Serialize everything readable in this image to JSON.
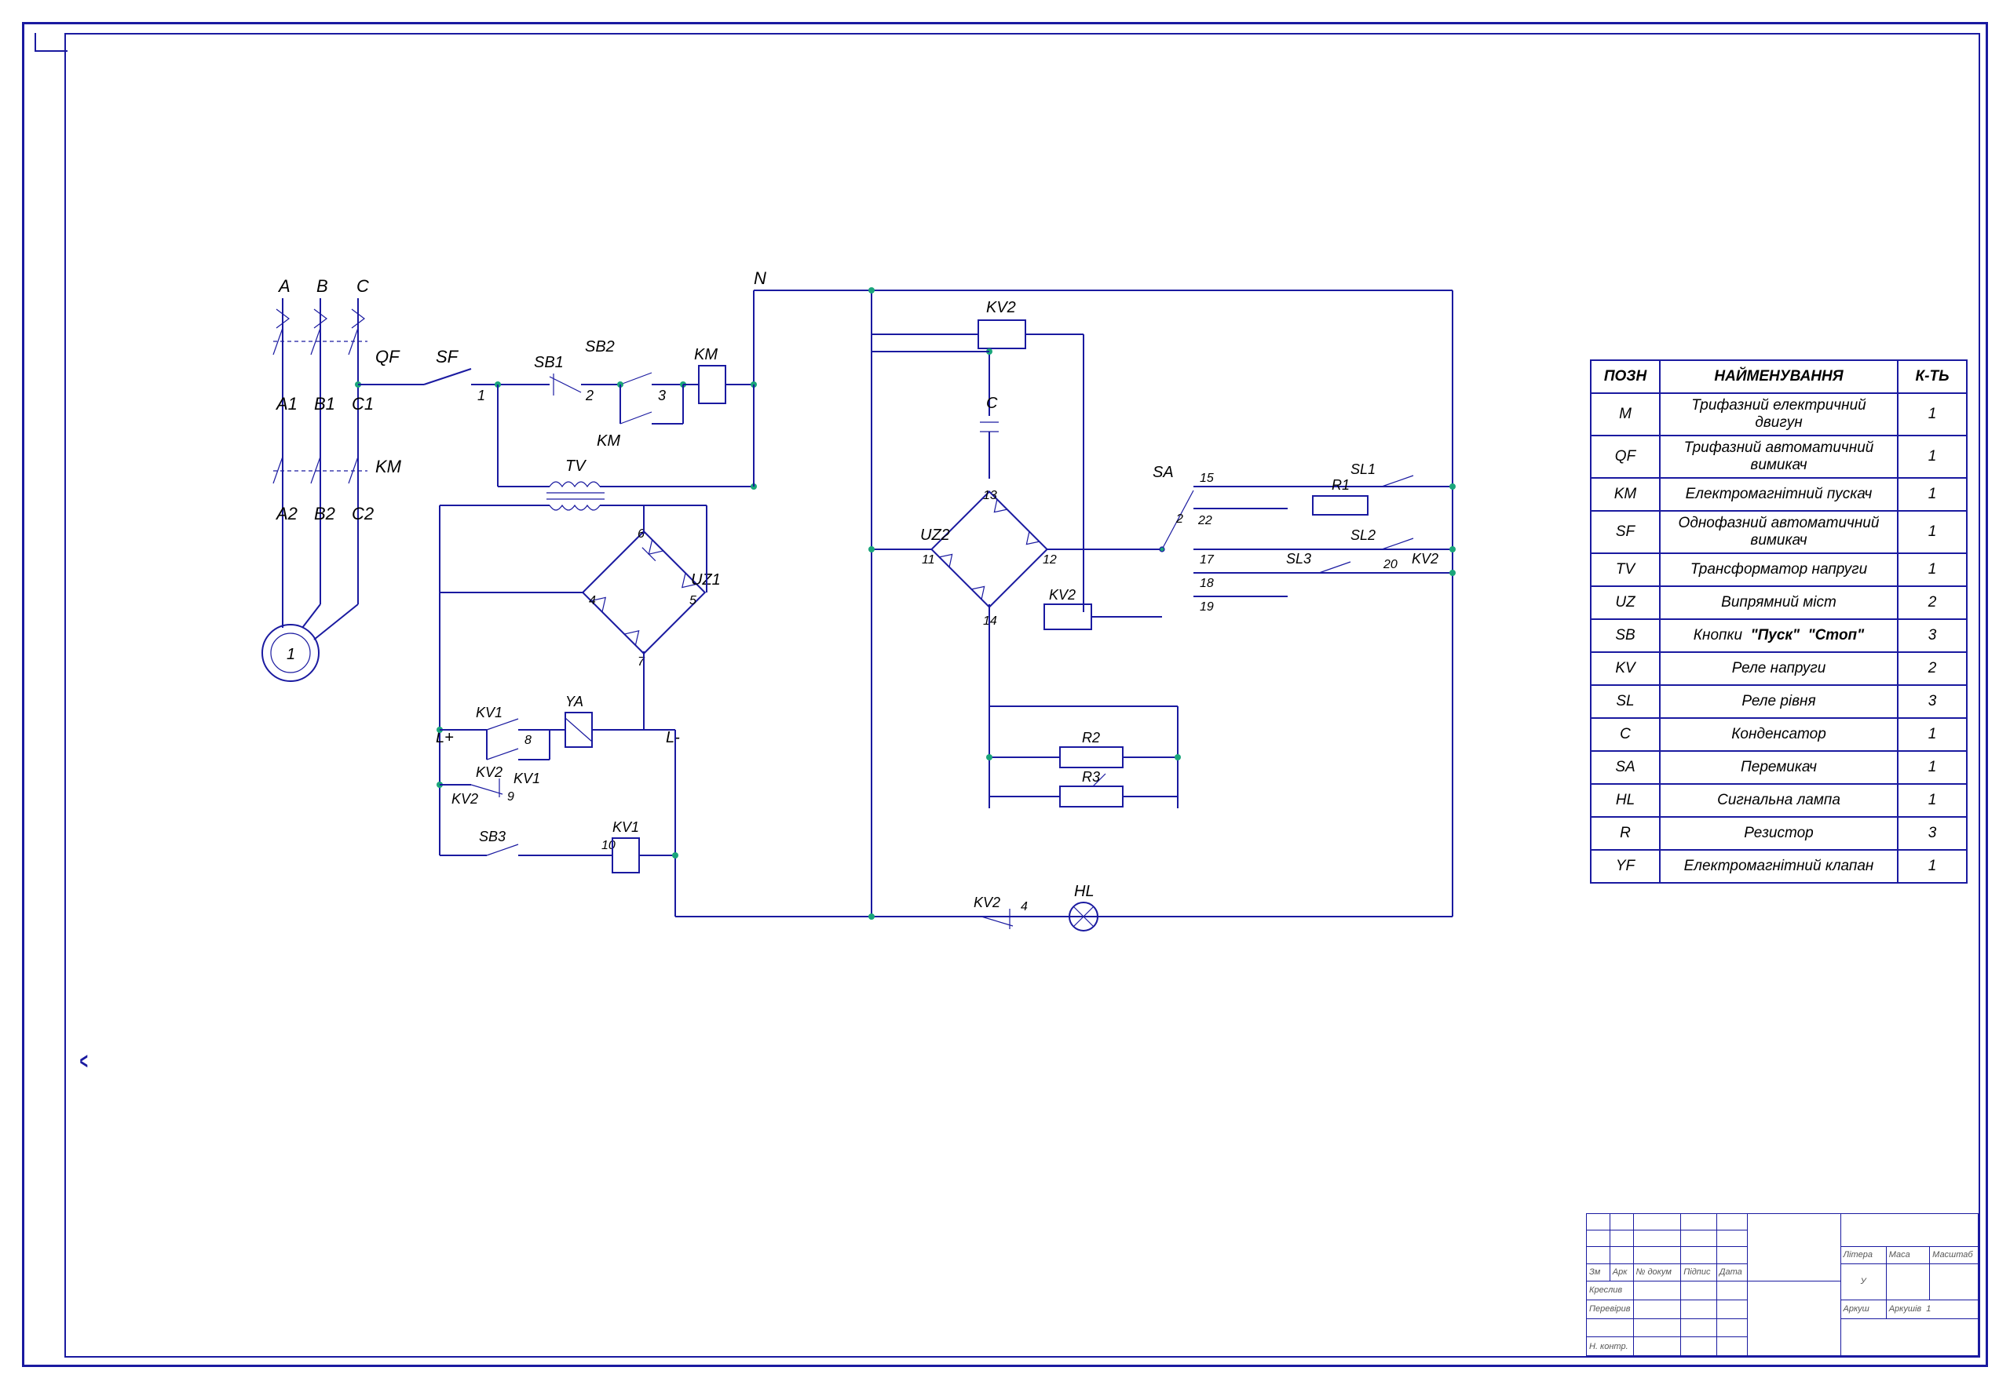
{
  "schematic": {
    "phases": {
      "A": "A",
      "B": "B",
      "C": "C",
      "N": "N"
    },
    "terminals": {
      "A1": "A1",
      "B1": "B1",
      "C1": "C1",
      "A2": "A2",
      "B2": "B2",
      "C2": "C2",
      "Lplus": "L+",
      "Lminus": "L-"
    },
    "components": {
      "QF": "QF",
      "SF": "SF",
      "SB1": "SB1",
      "SB2": "SB2",
      "SB3": "SB3",
      "KM": "KM",
      "TV": "TV",
      "UZ1": "UZ1",
      "UZ2": "UZ2",
      "KV1": "KV1",
      "KV2": "KV2",
      "YA": "YA",
      "SA": "SA",
      "SL1": "SL1",
      "SL2": "SL2",
      "SL3": "SL3",
      "R1": "R1",
      "R2": "R2",
      "R3": "R3",
      "C": "C",
      "HL": "HL",
      "motor": "1"
    },
    "node_numbers": [
      "1",
      "2",
      "3",
      "4",
      "5",
      "6",
      "7",
      "8",
      "9",
      "10",
      "11",
      "12",
      "13",
      "14",
      "15",
      "17",
      "18",
      "19",
      "20",
      "22",
      "4"
    ]
  },
  "parts_table": {
    "headers": {
      "des": "ПОЗН",
      "name": "НАЙМЕНУВАННЯ",
      "qty": "К-ТЬ"
    },
    "rows": [
      {
        "des": "M",
        "name": "Трифазний електричний двигун",
        "qty": "1"
      },
      {
        "des": "QF",
        "name": "Трифазний автоматичний вимикач",
        "qty": "1"
      },
      {
        "des": "KM",
        "name": "Електромагнітний пускач",
        "qty": "1"
      },
      {
        "des": "SF",
        "name": "Однофазний автоматичний вимикач",
        "qty": "1"
      },
      {
        "des": "TV",
        "name": "Трансформатор напруги",
        "qty": "1"
      },
      {
        "des": "UZ",
        "name": "Випрямний міст",
        "qty": "2"
      },
      {
        "des": "SB",
        "name": "Кнопки  \"Пуск\"  \"Стоп\"",
        "qty": "3"
      },
      {
        "des": "KV",
        "name": "Реле напруги",
        "qty": "2"
      },
      {
        "des": "SL",
        "name": "Реле рівня",
        "qty": "3"
      },
      {
        "des": "C",
        "name": "Конденсатор",
        "qty": "1"
      },
      {
        "des": "SA",
        "name": "Перемикач",
        "qty": "1"
      },
      {
        "des": "HL",
        "name": "Сигнальна лампа",
        "qty": "1"
      },
      {
        "des": "R",
        "name": "Резистор",
        "qty": "3"
      },
      {
        "des": "YF",
        "name": "Електромагнітний клапан",
        "qty": "1"
      }
    ]
  },
  "title_block": {
    "row_labels": [
      "Зм",
      "Арк",
      "№  докум",
      "Підпис",
      "Дата"
    ],
    "left_rows": [
      "Креслив",
      "Перевірив",
      "Н. контр."
    ],
    "right_headers": [
      "Літера",
      "Маса",
      "Масштаб"
    ],
    "sheet_labels": [
      "Аркуш",
      "Аркушів"
    ],
    "letter": "У",
    "sheets": "1"
  }
}
